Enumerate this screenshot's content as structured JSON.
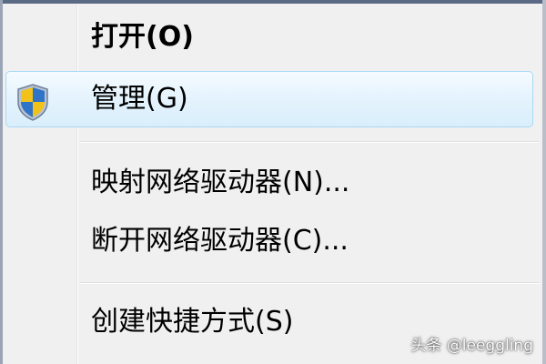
{
  "menu": {
    "items": [
      {
        "label": "打开(O)",
        "bold": true
      },
      {
        "label": "管理(G)",
        "icon": "uac-shield-icon",
        "highlighted": true
      },
      {
        "label": "映射网络驱动器(N)..."
      },
      {
        "label": "断开网络驱动器(C)..."
      },
      {
        "label": "创建快捷方式(S)"
      }
    ]
  },
  "watermark": "头条 @leeggling",
  "colors": {
    "background": "#f0f0f0",
    "highlight_border": "#a8d8f5",
    "shield_blue": "#2f74c7",
    "shield_yellow": "#f2c21a"
  }
}
